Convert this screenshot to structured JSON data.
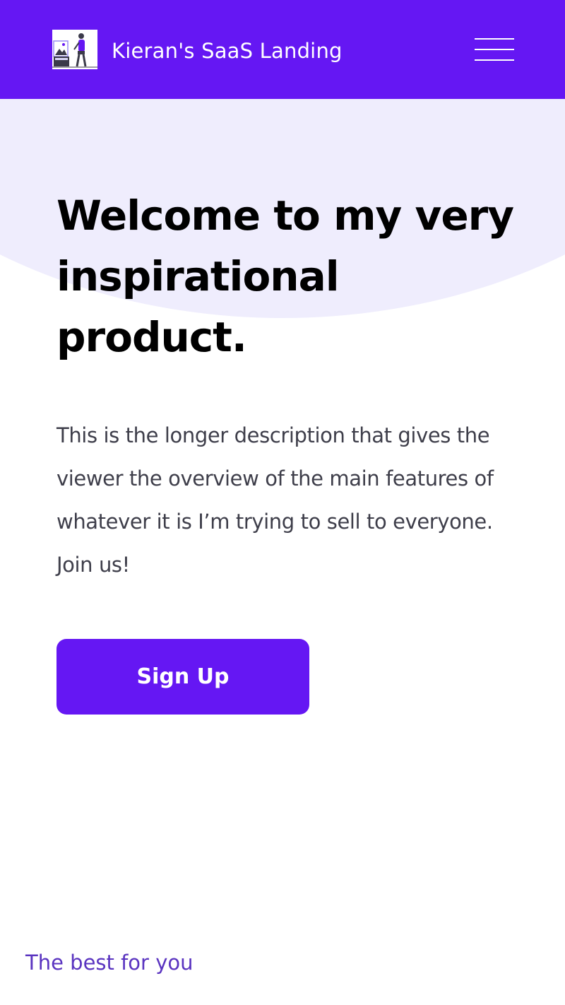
{
  "header": {
    "brand_name": "Kieran's SaaS Landing",
    "logo_icon": "person-with-picture-illustration",
    "menu_icon": "hamburger-menu-icon"
  },
  "hero": {
    "title": "Welcome to my very inspirational product.",
    "description": "This is the longer description that gives the viewer the overview of the main features of whatever it is I’m trying to sell to everyone. Join us!",
    "cta_label": "Sign Up"
  },
  "footer": {
    "tagline": "The best for you"
  },
  "colors": {
    "brand": "#6517f3",
    "hero_background": "#efedfd",
    "tagline": "#5a34c0"
  }
}
